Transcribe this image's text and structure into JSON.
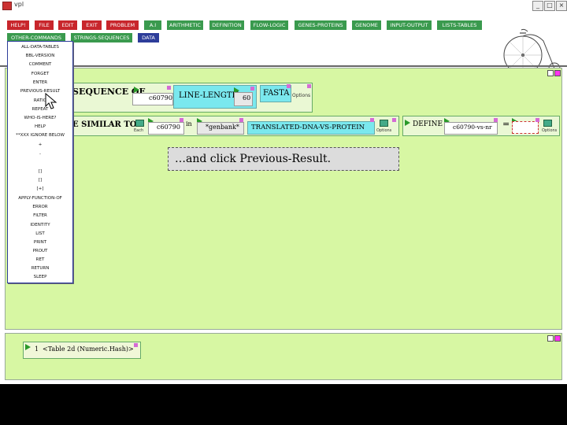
{
  "window": {
    "title": "vpl"
  },
  "menu": {
    "row1": [
      {
        "label": "HELP!",
        "color": "red"
      },
      {
        "label": "FILE",
        "color": "red"
      },
      {
        "label": "EDIT",
        "color": "red"
      },
      {
        "label": "EXIT",
        "color": "red"
      },
      {
        "label": "PROBLEM",
        "color": "red"
      },
      {
        "label": "A.I",
        "color": "green"
      },
      {
        "label": "ARITHMETIC",
        "color": "green"
      },
      {
        "label": "DEFINITION",
        "color": "green"
      },
      {
        "label": "FLOW-LOGIC",
        "color": "green"
      },
      {
        "label": "GENES-PROTEINS",
        "color": "green"
      },
      {
        "label": "GENOME",
        "color": "green"
      },
      {
        "label": "INPUT-OUTPUT",
        "color": "green"
      },
      {
        "label": "LISTS-TABLES",
        "color": "green"
      }
    ],
    "row2": [
      {
        "label": "OTHER-COMMANDS",
        "color": "green"
      },
      {
        "label": "STRINGS-SEQUENCES",
        "color": "green"
      },
      {
        "label": "DATA",
        "color": "blue"
      }
    ]
  },
  "dropdown": {
    "items": [
      "ALL-DATA-TABLES",
      "BBL-VERSION",
      "COMMENT",
      "FORGET",
      "ENTER",
      "PREVIOUS-RESULT",
      "RATIO",
      "REPEAT",
      "WHO-IS-HERE?",
      "HELP",
      "**XXX IGNORE BELOW",
      "+",
      "-",
      "[]",
      "[]",
      "[+]",
      "APPLY-FUNCTION-OF",
      "ERROR",
      "FILTER",
      "IDENTITY",
      "LIST",
      "PRINT",
      "PROUT",
      "RET",
      "RETURN",
      "SLEEP"
    ]
  },
  "workspace": {
    "row1": {
      "label": "SEQUENCE OF",
      "var1": "c60790",
      "func": "LINE-LENGTH",
      "num": "60",
      "fasta": "FASTA",
      "options": "Options"
    },
    "row2": {
      "label": "E SIMILAR TO",
      "each": "Each",
      "var1": "c60790",
      "in": "in",
      "db": "*genbank*",
      "method": "TRANSLATED-DNA-VS-PROTEIN",
      "options": "Options",
      "define": "DEFINE",
      "defvar": "c60790-vs-nr",
      "eq": "="
    },
    "callout": {
      "prefix": "…and click ",
      "emph": "Previous-Result",
      "suffix": "."
    }
  },
  "results": {
    "index": "1",
    "value": "<Table 2d (Numeric.Hash)>"
  },
  "colors": {
    "workspace": "#d7f7a3",
    "menu_red": "#c8262c",
    "menu_green": "#3a9a4e",
    "menu_blue": "#2d3d9a",
    "cyan_box": "#7ae8ee"
  }
}
